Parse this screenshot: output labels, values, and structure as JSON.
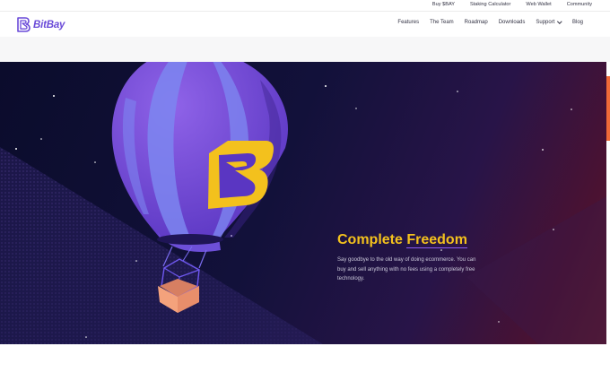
{
  "topbar": {
    "links": [
      "Buy $BAY",
      "Staking Calculator",
      "Web Wallet",
      "Community"
    ]
  },
  "nav": {
    "logo_text": "BitBay",
    "items": [
      "Features",
      "The Team",
      "Roadmap",
      "Downloads",
      "Support",
      "Blog"
    ]
  },
  "hero": {
    "headline_prefix": "Complete",
    "headline_highlight": "Freedom",
    "description": "Say goodbye to the old way of doing ecommerce. You can buy and sell anything with no fees using a completely free technology."
  },
  "colors": {
    "brand_purple": "#6a4ad8",
    "headline_yellow": "#f3c11d",
    "hero_background": "#12113a",
    "scroll_accent": "#f06a38"
  },
  "icons": {
    "logo": "bitbay-logo-icon",
    "balloon": "hot-air-balloon-illustration",
    "support_dropdown": "chevron-down-icon"
  }
}
